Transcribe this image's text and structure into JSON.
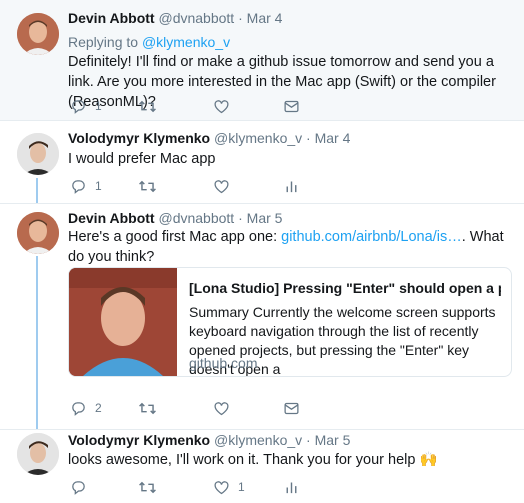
{
  "tweets": [
    {
      "name": "Devin Abbott",
      "handle": "@dvnabbott",
      "sep": "·",
      "date": "Mar 4",
      "replying_prefix": "Replying to ",
      "replying_to": "@klymenko_v",
      "text": "Definitely! I'll find or make a github issue tomorrow and send you a link. Are you more interested in the Mac app (Swift) or the compiler (ReasonML)?",
      "reply_count": "1",
      "retweet_count": "",
      "like_count": ""
    },
    {
      "name": "Volodymyr Klymenko",
      "handle": "@klymenko_v",
      "sep": "·",
      "date": "Mar 4",
      "text": "I would prefer Mac app",
      "reply_count": "1",
      "retweet_count": "",
      "like_count": ""
    },
    {
      "name": "Devin Abbott",
      "handle": "@dvnabbott",
      "sep": "·",
      "date": "Mar 5",
      "text_before": "Here's a good first Mac app one: ",
      "link": "github.com/airbnb/Lona/is…",
      "text_after": ". What do you think?",
      "reply_count": "2",
      "retweet_count": "",
      "like_count": "",
      "card": {
        "title": "[Lona Studio] Pressing \"Enter\" should open a proj…",
        "description": "Summary Currently the welcome screen supports keyboard navigation through the list of recently opened projects, but pressing the \"Enter\" key doesn't open a",
        "domain": "github.com"
      }
    },
    {
      "name": "Volodymyr Klymenko",
      "handle": "@klymenko_v",
      "sep": "·",
      "date": "Mar 5",
      "text": "looks awesome, I'll work on it. Thank you for your help 🙌",
      "reply_count": "",
      "retweet_count": "",
      "like_count": "1"
    }
  ],
  "icons": {
    "reply": "reply-icon",
    "retweet": "retweet-icon",
    "like": "like-icon",
    "message": "direct-message-icon",
    "analytics": "analytics-icon"
  },
  "colors": {
    "link": "#1da1f2",
    "thread_line": "#9fcbef",
    "muted": "#657786",
    "highlight_bg": "#f5f8fa"
  }
}
